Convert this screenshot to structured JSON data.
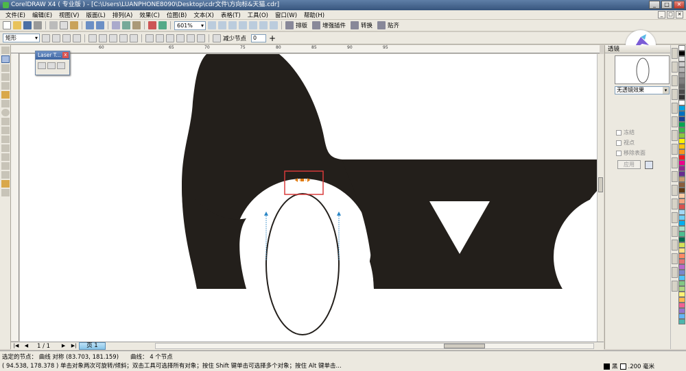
{
  "window": {
    "title": "CorelDRAW X4 ( 专业版 ) - [C:\\Users\\LUANPHONE8090\\Desktop\\cdr文件\\方向标&天猫.cdr]",
    "min": "_",
    "max": "□",
    "close": "✕"
  },
  "menu": [
    "文件(E)",
    "编辑(E)",
    "视图(V)",
    "版面(L)",
    "排列(A)",
    "效果(C)",
    "位图(B)",
    "文本(X)",
    "表格(T)",
    "工具(O)",
    "窗口(W)",
    "帮助(H)"
  ],
  "toolbar": {
    "zoom": "601%",
    "btn_arrange": "排版",
    "btn_plugin": "增强插件",
    "btn_convert": "转换",
    "btn_align": "贴齐"
  },
  "propertybar": {
    "object_type": "矩形",
    "reduce_nodes_label": "减少节点",
    "reduce_nodes_value": "0"
  },
  "ruler": {
    "h_ticks": [
      "60",
      "65",
      "70",
      "75",
      "80",
      "85",
      "90",
      "95"
    ],
    "v_ticks": []
  },
  "laser_popup": {
    "title": "Laser T...",
    "close": "x"
  },
  "docker": {
    "title": "透镜",
    "lens_effect": "无透镜效果",
    "freeze": "冻结",
    "viewpoint": "视点",
    "remove_face": "移除表面",
    "apply": "应用"
  },
  "palette": {
    "colors": [
      "#ffffff",
      "#000000",
      "#e6e6e6",
      "#cccccc",
      "#b3b3b3",
      "#999999",
      "#808080",
      "#666666",
      "#4d4d4d",
      "#333333",
      "#ffffff",
      "#00a3e0",
      "#0070c0",
      "#1c3f94",
      "#00a651",
      "#39b54a",
      "#8dc63f",
      "#fff200",
      "#ffc20e",
      "#f7941d",
      "#ed1c24",
      "#ec008c",
      "#92278f",
      "#662d91",
      "#c69c6d",
      "#8b5e3c",
      "#603913",
      "#f9c9a3",
      "#f4a582",
      "#d9534f",
      "#a3d8f4",
      "#6dcff6",
      "#00aeef",
      "#a8e0c8",
      "#4dbd90",
      "#006a4e",
      "#d4e157",
      "#ffe082",
      "#ff8a65",
      "#e57373",
      "#ba68c8",
      "#7986cb",
      "#4fc3f7",
      "#81c784",
      "#aed581",
      "#fff176",
      "#ffb74d",
      "#f06292",
      "#9575cd",
      "#64b5f6",
      "#4db6ac"
    ]
  },
  "pagebar": {
    "nav_first": "|◀",
    "nav_prev": "◀",
    "page_count": "1 / 1",
    "nav_next": "▶",
    "nav_last": "▶|",
    "page_tab": "页 1"
  },
  "status": {
    "selected_nodes": "选定的节点：  曲线  对称  (83.703, 181.159)",
    "curve_info": "曲线：  4 个节点",
    "hint": "( 94.538, 178.378 )  单击对象两次可旋转/倾斜；双击工具可选择所有对象；按住 Shift 键单击可选择多个对象；按住 Alt 键单击...",
    "fill": "黑",
    "outline": ".200 毫米"
  },
  "colors": {
    "shape_fill": "#231f1b",
    "highlight": "#d83a3a",
    "node_orange": "#e07a10",
    "handle_blue": "#2a86c6"
  }
}
